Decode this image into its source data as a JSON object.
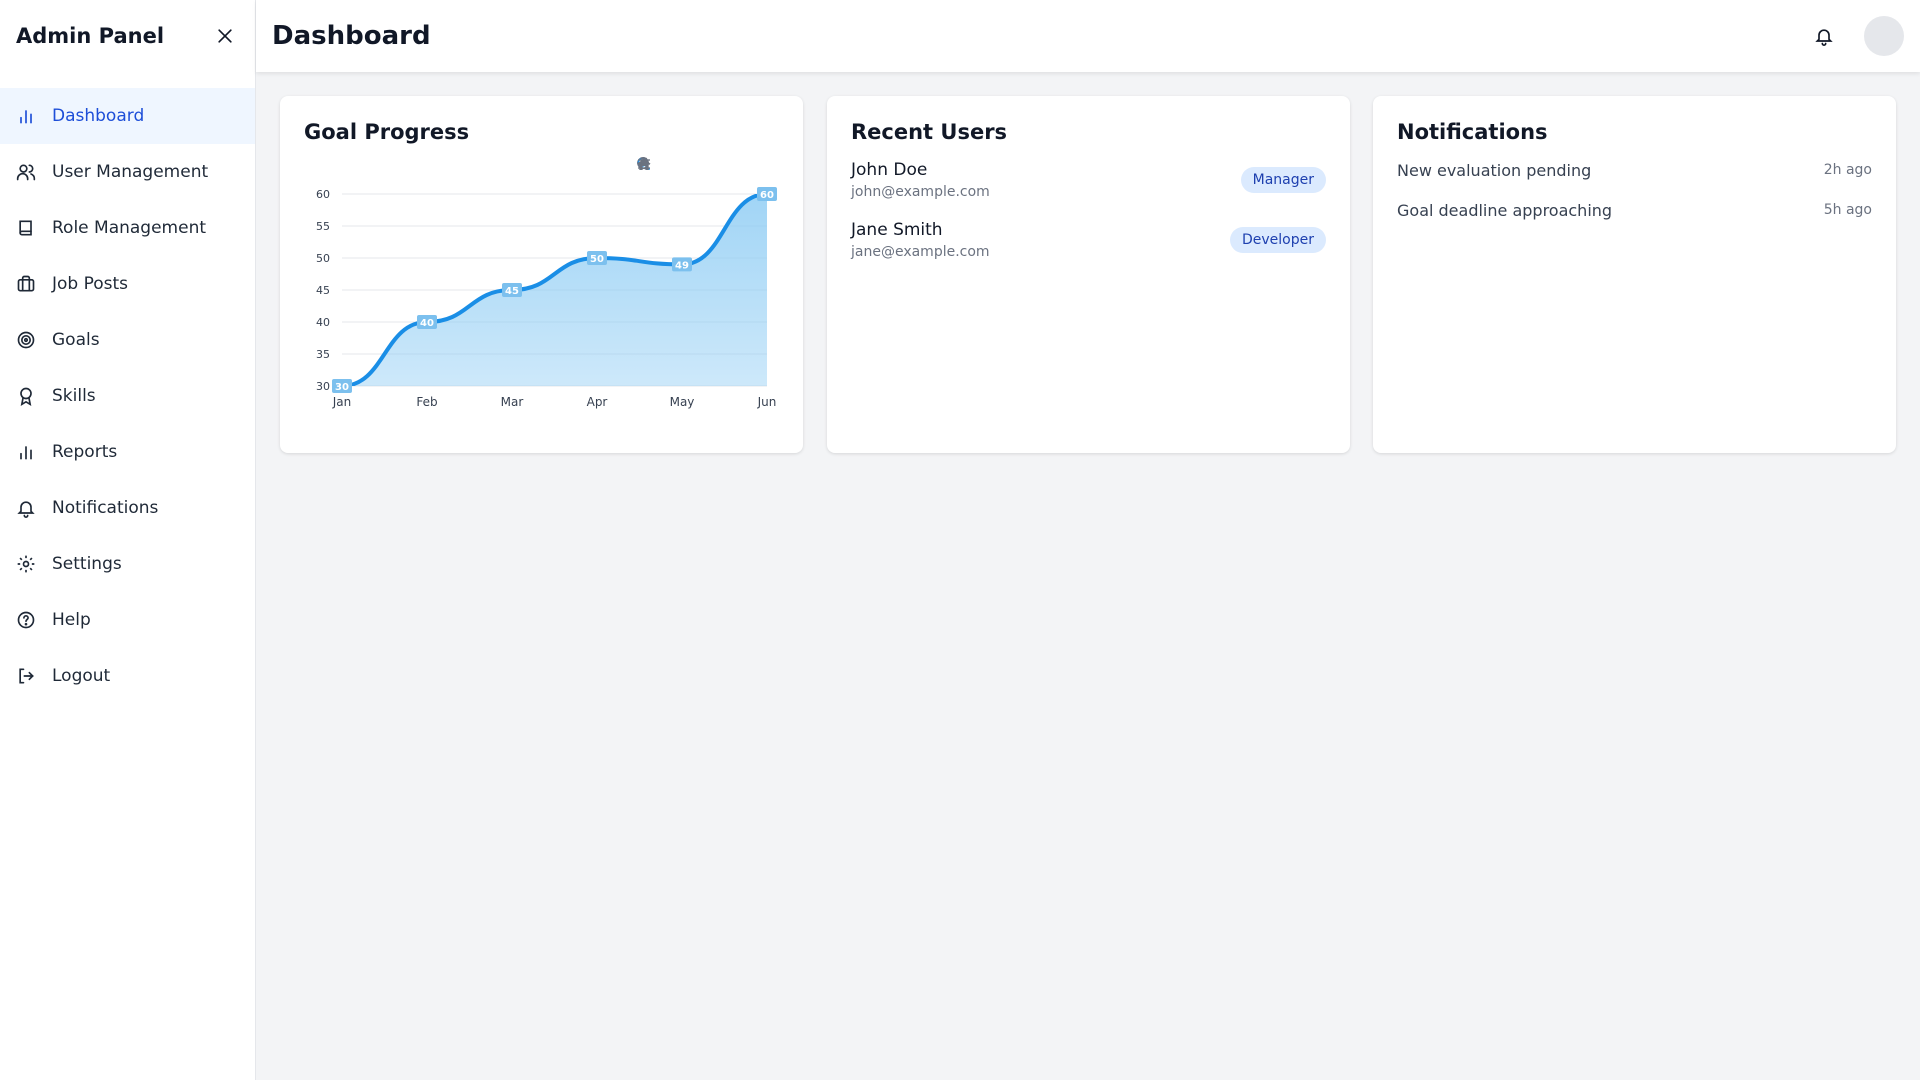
{
  "sidebar": {
    "title": "Admin Panel",
    "items": [
      {
        "label": "Dashboard",
        "icon": "bar-chart-icon",
        "active": true
      },
      {
        "label": "User Management",
        "icon": "users-icon"
      },
      {
        "label": "Role Management",
        "icon": "book-icon"
      },
      {
        "label": "Job Posts",
        "icon": "briefcase-icon"
      },
      {
        "label": "Goals",
        "icon": "target-icon"
      },
      {
        "label": "Skills",
        "icon": "award-icon"
      },
      {
        "label": "Reports",
        "icon": "bar-chart-icon"
      },
      {
        "label": "Notifications",
        "icon": "bell-icon"
      },
      {
        "label": "Settings",
        "icon": "gear-icon"
      },
      {
        "label": "Help",
        "icon": "help-circle-icon"
      },
      {
        "label": "Logout",
        "icon": "logout-icon"
      }
    ]
  },
  "header": {
    "title": "Dashboard"
  },
  "goal_card": {
    "title": "Goal Progress"
  },
  "users_card": {
    "title": "Recent Users",
    "users": [
      {
        "name": "John Doe",
        "email": "john@example.com",
        "role": "Manager"
      },
      {
        "name": "Jane Smith",
        "email": "jane@example.com",
        "role": "Developer"
      }
    ]
  },
  "notifications_card": {
    "title": "Notifications",
    "items": [
      {
        "text": "New evaluation pending",
        "time": "2h ago"
      },
      {
        "text": "Goal deadline approaching",
        "time": "5h ago"
      }
    ]
  },
  "colors": {
    "accent": "#1d4ed8",
    "series": "#1a8ee6",
    "fill": "#90cdf4"
  },
  "chart_data": {
    "type": "area",
    "categories": [
      "Jan",
      "Feb",
      "Mar",
      "Apr",
      "May",
      "Jun"
    ],
    "values": [
      30,
      40,
      45,
      50,
      49,
      60
    ],
    "ylim": [
      30,
      60
    ],
    "yticks": [
      30,
      35,
      40,
      45,
      50,
      55,
      60
    ],
    "grid": true,
    "data_labels": true,
    "title": "",
    "xlabel": "",
    "ylabel": ""
  }
}
